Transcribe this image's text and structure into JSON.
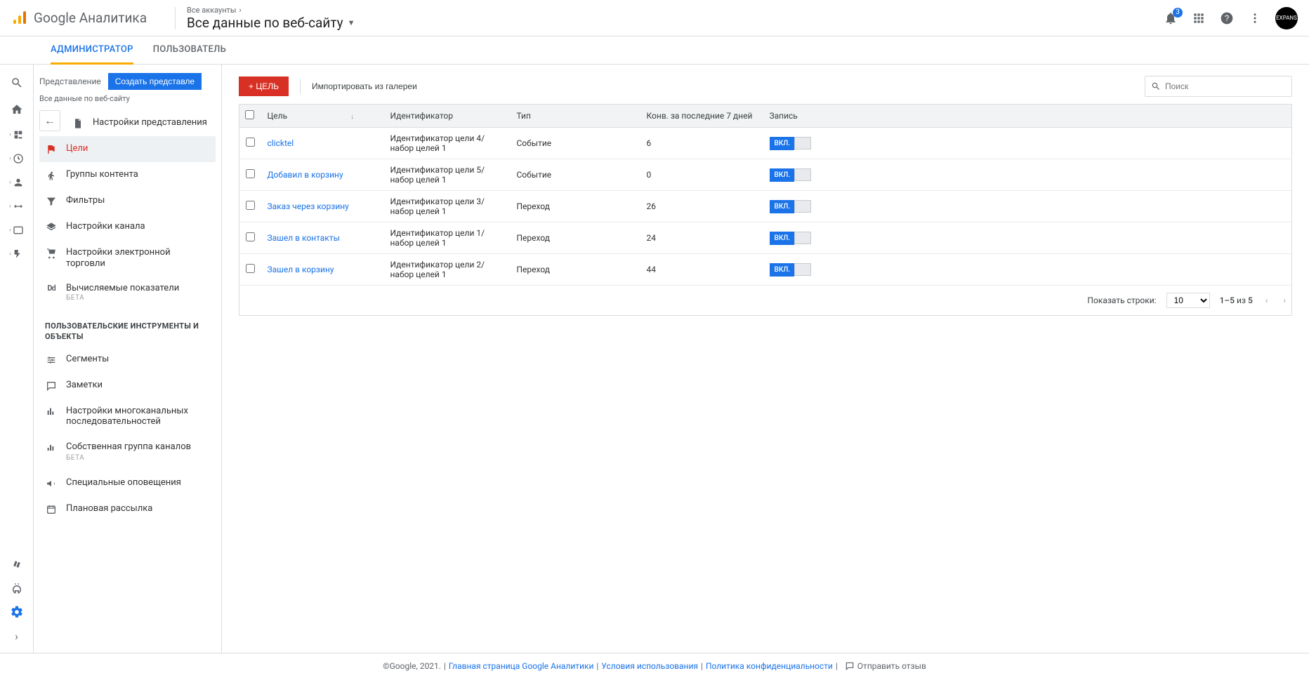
{
  "header": {
    "product": "Google Аналитика",
    "accounts_label": "Все аккаунты",
    "view_title": "Все данные по веб-сайту",
    "notif_count": "3",
    "avatar_text": "EXPANS"
  },
  "tabs": {
    "admin": "АДМИНИСТРАТОР",
    "user": "ПОЛЬЗОВАТЕЛЬ"
  },
  "side": {
    "view_label": "Представление",
    "create_view": "Создать представле",
    "view_name": "Все данные по веб-сайту",
    "items": [
      {
        "label": "Настройки представления"
      },
      {
        "label": "Цели"
      },
      {
        "label": "Группы контента"
      },
      {
        "label": "Фильтры"
      },
      {
        "label": "Настройки канала"
      },
      {
        "label": "Настройки электронной торговли"
      },
      {
        "label": "Вычисляемые показатели",
        "beta": "БЕТА"
      }
    ],
    "group_header": "ПОЛЬЗОВАТЕЛЬСКИЕ ИНСТРУМЕНТЫ И ОБЪЕКТЫ",
    "items2": [
      {
        "label": "Сегменты"
      },
      {
        "label": "Заметки"
      },
      {
        "label": "Настройки многоканальных последовательностей"
      },
      {
        "label": "Собственная группа каналов",
        "beta": "БЕТА"
      },
      {
        "label": "Специальные оповещения"
      },
      {
        "label": "Плановая рассылка"
      }
    ]
  },
  "toolbar": {
    "add_goal": "+ ЦЕЛЬ",
    "import_gallery": "Импортировать из галереи",
    "search_placeholder": "Поиск"
  },
  "table": {
    "headers": {
      "goal": "Цель",
      "ident": "Идентификатор",
      "type": "Тип",
      "conv": "Конв. за последние 7 дней",
      "record": "Запись"
    },
    "toggle_label": "ВКЛ.",
    "rows": [
      {
        "name": "clicktel",
        "ident": "Идентификатор цели 4/набор целей 1",
        "type": "Событие",
        "conv": "6"
      },
      {
        "name": "Добавил в корзину",
        "ident": "Идентификатор цели 5/набор целей 1",
        "type": "Событие",
        "conv": "0"
      },
      {
        "name": "Заказ через корзину",
        "ident": "Идентификатор цели 3/набор целей 1",
        "type": "Переход",
        "conv": "26"
      },
      {
        "name": "Зашел в контакты",
        "ident": "Идентификатор цели 1/набор целей 1",
        "type": "Переход",
        "conv": "24"
      },
      {
        "name": "Зашел в корзину",
        "ident": "Идентификатор цели 2/набор целей 1",
        "type": "Переход",
        "conv": "44"
      }
    ]
  },
  "pager": {
    "rows_label": "Показать строки:",
    "rows_value": "10",
    "range_prefix": "1–5",
    "of": "из",
    "total": "5"
  },
  "footer": {
    "copyright": "©Google, 2021.",
    "link1": "Главная страница Google Аналитики",
    "link2": "Условия использования",
    "link3": "Политика конфиденциальности",
    "feedback": "Отправить отзыв"
  }
}
